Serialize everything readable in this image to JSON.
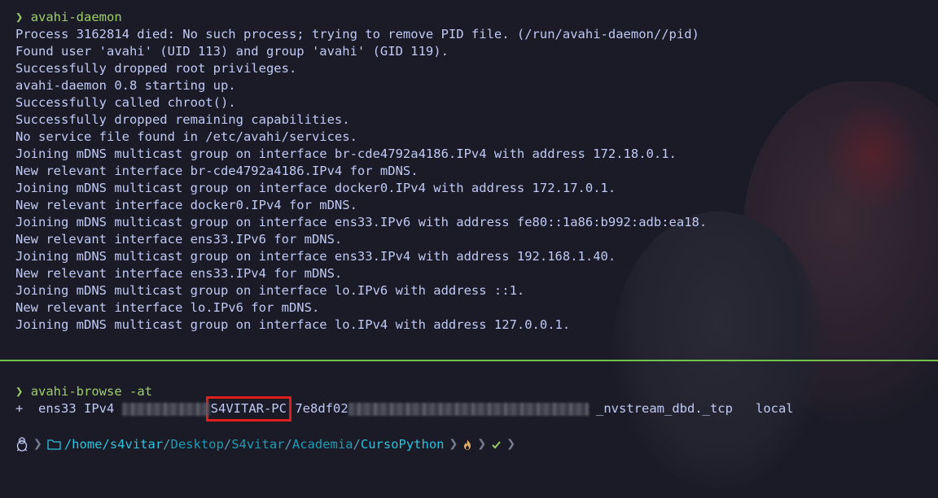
{
  "terminal": {
    "top_pane": {
      "prompt_symbol": "❯",
      "command": "avahi-daemon",
      "output_lines": [
        "Process 3162814 died: No such process; trying to remove PID file. (/run/avahi-daemon//pid)",
        "Found user 'avahi' (UID 113) and group 'avahi' (GID 119).",
        "Successfully dropped root privileges.",
        "avahi-daemon 0.8 starting up.",
        "Successfully called chroot().",
        "Successfully dropped remaining capabilities.",
        "No service file found in /etc/avahi/services.",
        "Joining mDNS multicast group on interface br-cde4792a4186.IPv4 with address 172.18.0.1.",
        "New relevant interface br-cde4792a4186.IPv4 for mDNS.",
        "Joining mDNS multicast group on interface docker0.IPv4 with address 172.17.0.1.",
        "New relevant interface docker0.IPv4 for mDNS.",
        "Joining mDNS multicast group on interface ens33.IPv6 with address fe80::1a86:b992:adb:ea18.",
        "New relevant interface ens33.IPv6 for mDNS.",
        "Joining mDNS multicast group on interface ens33.IPv4 with address 192.168.1.40.",
        "New relevant interface ens33.IPv4 for mDNS.",
        "Joining mDNS multicast group on interface lo.IPv6 with address ::1.",
        "New relevant interface lo.IPv6 for mDNS.",
        "Joining mDNS multicast group on interface lo.IPv4 with address 127.0.0.1."
      ]
    },
    "bottom_pane": {
      "prompt_symbol": "❯",
      "command": "avahi-browse -at",
      "result": {
        "prefix": "+  ens33 IPv4 ",
        "highlighted_name": "S4VITAR-PC",
        "id_visible": "7e8df02",
        "service_type": "_nvstream_dbd._tcp",
        "domain": "local"
      }
    },
    "status_bar": {
      "path_home": "/home/",
      "path_user": "s4vitar",
      "path_dirs": [
        "Desktop",
        "S4vitar",
        "Academia"
      ],
      "path_last": "CursoPython",
      "slash": "/",
      "linux_icon": "tux-icon",
      "folder_icon": "folder-icon",
      "fire_icon": "fire-icon",
      "check_icon": "check-icon"
    },
    "colors": {
      "background": "#1a1b26",
      "text": "#c0caf5",
      "prompt": "#9ece6a",
      "divider": "#73c24a",
      "highlight_box": "#e01e1e",
      "path": "#2ac3de"
    }
  }
}
